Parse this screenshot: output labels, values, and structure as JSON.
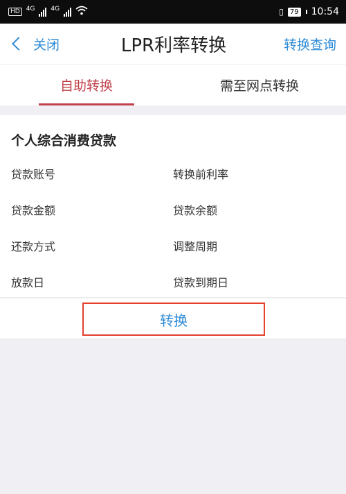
{
  "status_bar": {
    "hd": "HD",
    "net1": "4G",
    "net2": "4G",
    "battery": "79",
    "time": "10:54"
  },
  "nav": {
    "close_label": "关闭",
    "title": "LPR利率转换",
    "query_label": "转换查询"
  },
  "tabs": [
    {
      "label": "自助转换",
      "active": true
    },
    {
      "label": "需至网点转换",
      "active": false
    }
  ],
  "loan": {
    "title": "个人综合消费贷款",
    "fields": [
      "贷款账号",
      "转换前利率",
      "贷款金额",
      "贷款余额",
      "还款方式",
      "调整周期",
      "放款日",
      "贷款到期日"
    ]
  },
  "action": {
    "convert_label": "转换"
  },
  "colors": {
    "accent_blue": "#2e8bd6",
    "tab_red": "#c1404a",
    "highlight_red": "#e5402c"
  }
}
